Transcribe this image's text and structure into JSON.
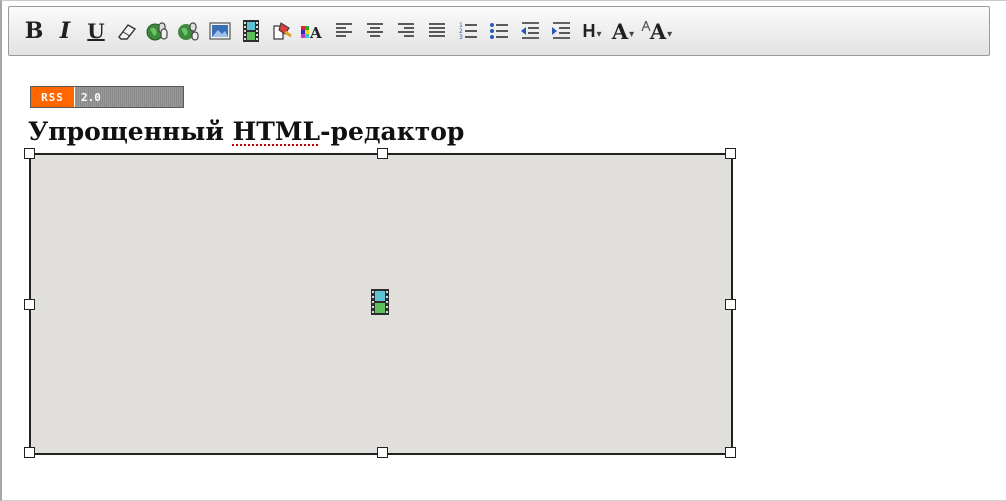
{
  "toolbar": {
    "bold_label": "B",
    "italic_label": "I",
    "underline_label": "U",
    "heading_label": "H",
    "font_size_label": "A",
    "font_color_label": "A",
    "dropdown_arrow": "▾",
    "icons": [
      "bold-icon",
      "italic-icon",
      "underline-icon",
      "eraser-icon",
      "insert-link-icon",
      "remove-link-icon",
      "insert-image-icon",
      "insert-media-icon",
      "format-painter-icon",
      "color-icon",
      "align-left-icon",
      "align-center-icon",
      "align-right-icon",
      "align-justify-icon",
      "ordered-list-icon",
      "unordered-list-icon",
      "outdent-icon",
      "indent-icon",
      "heading-menu-icon",
      "font-size-menu-icon",
      "font-color-menu-icon"
    ]
  },
  "content": {
    "rss_badge": {
      "left": "RSS",
      "right": "2.0"
    },
    "heading": {
      "before": "Упрощенный ",
      "misspelled": "HTML",
      "after": "-редактор"
    },
    "media_placeholder_icon": "film-icon"
  },
  "colors": {
    "rss_orange": "#ff6600",
    "media_bg": "#e1dfdb",
    "toolbar_border": "#9a9a9a"
  }
}
